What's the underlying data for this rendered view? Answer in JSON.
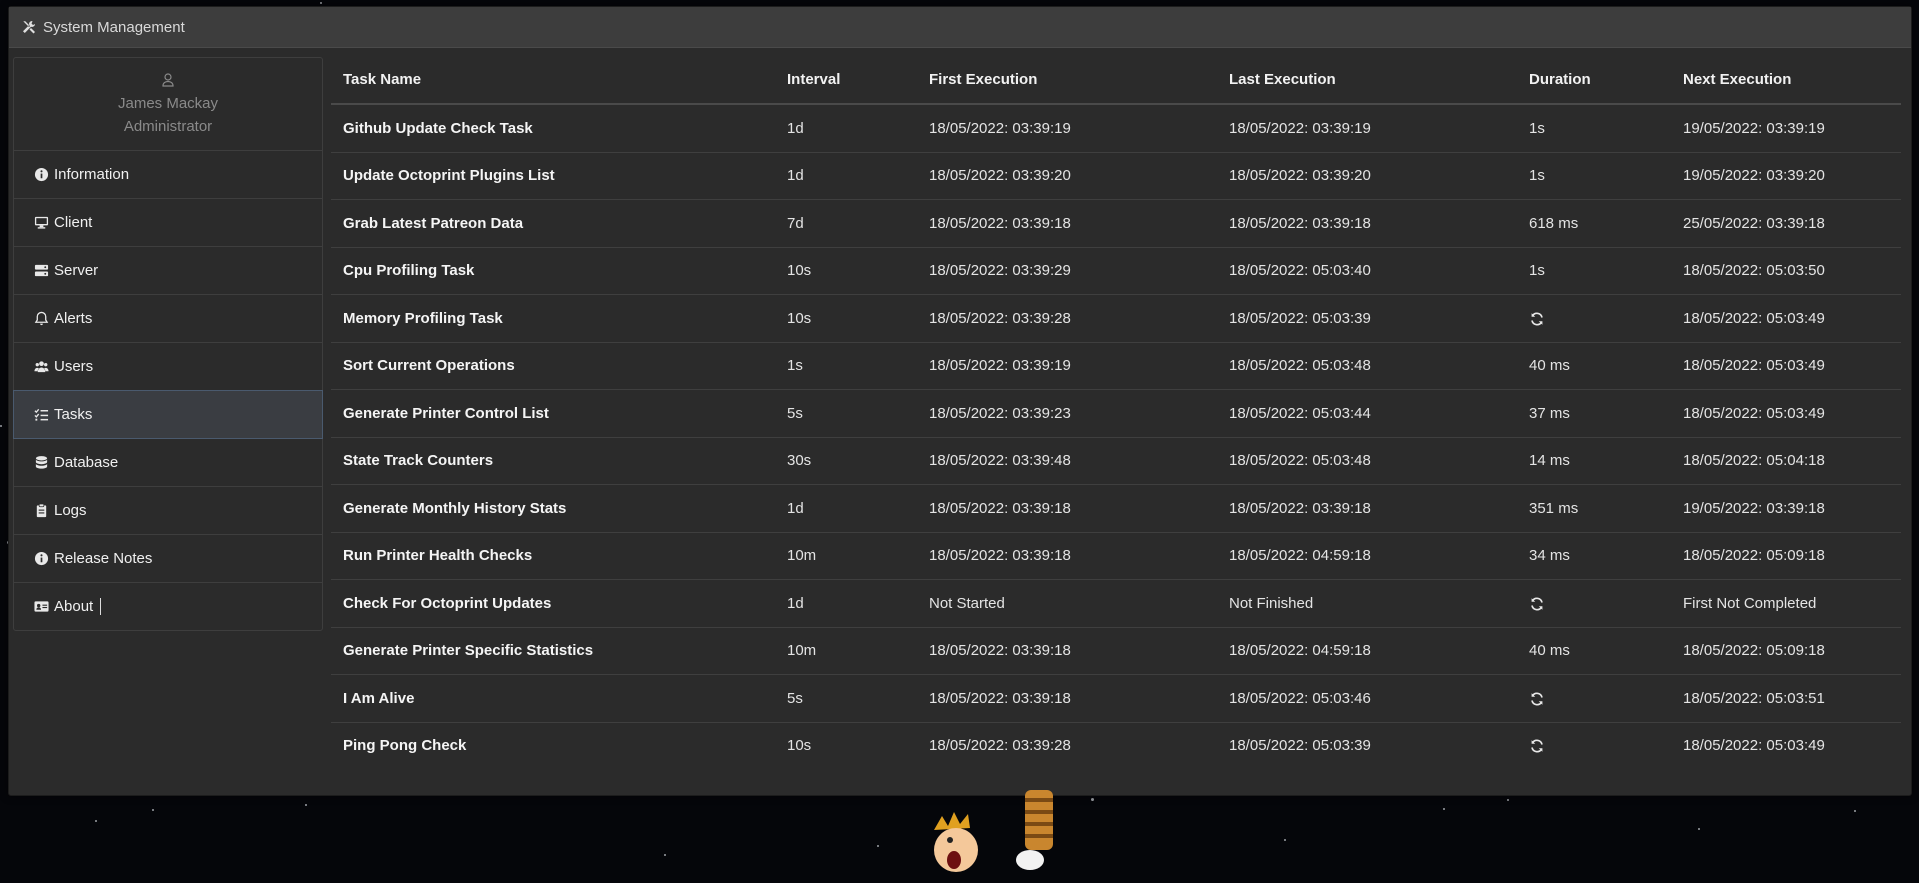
{
  "window": {
    "title": "System Management",
    "title_icon": "tools-icon"
  },
  "profile": {
    "icon": "user-icon",
    "name": "James Mackay",
    "role": "Administrator"
  },
  "sidebar": {
    "items": [
      {
        "label": "Information",
        "icon": "info-circle-icon"
      },
      {
        "label": "Client",
        "icon": "desktop-icon"
      },
      {
        "label": "Server",
        "icon": "server-icon"
      },
      {
        "label": "Alerts",
        "icon": "bell-icon"
      },
      {
        "label": "Users",
        "icon": "users-icon"
      },
      {
        "label": "Tasks",
        "icon": "tasks-icon",
        "active": true
      },
      {
        "label": "Database",
        "icon": "database-icon"
      },
      {
        "label": "Logs",
        "icon": "clipboard-icon"
      },
      {
        "label": "Release Notes",
        "icon": "info-circle-icon"
      },
      {
        "label": "About",
        "icon": "id-card-icon"
      }
    ]
  },
  "tasks_table": {
    "headers": [
      "Task Name",
      "Interval",
      "First Execution",
      "Last Execution",
      "Duration",
      "Next Execution"
    ],
    "rows": [
      [
        "Github Update Check Task",
        "1d",
        "18/05/2022: 03:39:19",
        "18/05/2022: 03:39:19",
        "1s",
        "19/05/2022: 03:39:19"
      ],
      [
        "Update Octoprint Plugins List",
        "1d",
        "18/05/2022: 03:39:20",
        "18/05/2022: 03:39:20",
        "1s",
        "19/05/2022: 03:39:20"
      ],
      [
        "Grab Latest Patreon Data",
        "7d",
        "18/05/2022: 03:39:18",
        "18/05/2022: 03:39:18",
        "618 ms",
        "25/05/2022: 03:39:18"
      ],
      [
        "Cpu Profiling Task",
        "10s",
        "18/05/2022: 03:39:29",
        "18/05/2022: 05:03:40",
        "1s",
        "18/05/2022: 05:03:50"
      ],
      [
        "Memory Profiling Task",
        "10s",
        "18/05/2022: 03:39:28",
        "18/05/2022: 05:03:39",
        "",
        "18/05/2022: 05:03:49"
      ],
      [
        "Sort Current Operations",
        "1s",
        "18/05/2022: 03:39:19",
        "18/05/2022: 05:03:48",
        "40 ms",
        "18/05/2022: 05:03:49"
      ],
      [
        "Generate Printer Control List",
        "5s",
        "18/05/2022: 03:39:23",
        "18/05/2022: 05:03:44",
        "37 ms",
        "18/05/2022: 05:03:49"
      ],
      [
        "State Track Counters",
        "30s",
        "18/05/2022: 03:39:48",
        "18/05/2022: 05:03:48",
        "14 ms",
        "18/05/2022: 05:04:18"
      ],
      [
        "Generate Monthly History Stats",
        "1d",
        "18/05/2022: 03:39:18",
        "18/05/2022: 03:39:18",
        "351 ms",
        "19/05/2022: 03:39:18"
      ],
      [
        "Run Printer Health Checks",
        "10m",
        "18/05/2022: 03:39:18",
        "18/05/2022: 04:59:18",
        "34 ms",
        "18/05/2022: 05:09:18"
      ],
      [
        "Check For Octoprint Updates",
        "1d",
        "Not Started",
        "Not Finished",
        "",
        "First Not Completed"
      ],
      [
        "Generate Printer Specific Statistics",
        "10m",
        "18/05/2022: 03:39:18",
        "18/05/2022: 04:59:18",
        "40 ms",
        "18/05/2022: 05:09:18"
      ],
      [
        "I Am Alive",
        "5s",
        "18/05/2022: 03:39:18",
        "18/05/2022: 05:03:46",
        "",
        "18/05/2022: 05:03:51"
      ],
      [
        "Ping Pong Check",
        "10s",
        "18/05/2022: 03:39:28",
        "18/05/2022: 05:03:39",
        "",
        "18/05/2022: 05:03:49"
      ]
    ],
    "running_icon": "sync-icon"
  }
}
